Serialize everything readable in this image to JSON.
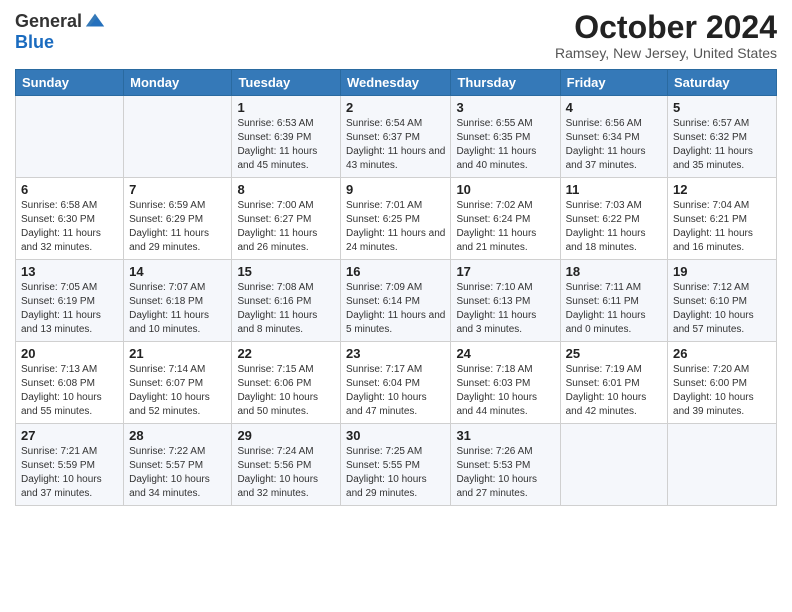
{
  "header": {
    "logo_general": "General",
    "logo_blue": "Blue",
    "title": "October 2024",
    "location": "Ramsey, New Jersey, United States"
  },
  "days_of_week": [
    "Sunday",
    "Monday",
    "Tuesday",
    "Wednesday",
    "Thursday",
    "Friday",
    "Saturday"
  ],
  "weeks": [
    [
      null,
      null,
      {
        "day": 1,
        "sunrise": "6:53 AM",
        "sunset": "6:39 PM",
        "daylight": "11 hours and 45 minutes."
      },
      {
        "day": 2,
        "sunrise": "6:54 AM",
        "sunset": "6:37 PM",
        "daylight": "11 hours and 43 minutes."
      },
      {
        "day": 3,
        "sunrise": "6:55 AM",
        "sunset": "6:35 PM",
        "daylight": "11 hours and 40 minutes."
      },
      {
        "day": 4,
        "sunrise": "6:56 AM",
        "sunset": "6:34 PM",
        "daylight": "11 hours and 37 minutes."
      },
      {
        "day": 5,
        "sunrise": "6:57 AM",
        "sunset": "6:32 PM",
        "daylight": "11 hours and 35 minutes."
      }
    ],
    [
      {
        "day": 6,
        "sunrise": "6:58 AM",
        "sunset": "6:30 PM",
        "daylight": "11 hours and 32 minutes."
      },
      {
        "day": 7,
        "sunrise": "6:59 AM",
        "sunset": "6:29 PM",
        "daylight": "11 hours and 29 minutes."
      },
      {
        "day": 8,
        "sunrise": "7:00 AM",
        "sunset": "6:27 PM",
        "daylight": "11 hours and 26 minutes."
      },
      {
        "day": 9,
        "sunrise": "7:01 AM",
        "sunset": "6:25 PM",
        "daylight": "11 hours and 24 minutes."
      },
      {
        "day": 10,
        "sunrise": "7:02 AM",
        "sunset": "6:24 PM",
        "daylight": "11 hours and 21 minutes."
      },
      {
        "day": 11,
        "sunrise": "7:03 AM",
        "sunset": "6:22 PM",
        "daylight": "11 hours and 18 minutes."
      },
      {
        "day": 12,
        "sunrise": "7:04 AM",
        "sunset": "6:21 PM",
        "daylight": "11 hours and 16 minutes."
      }
    ],
    [
      {
        "day": 13,
        "sunrise": "7:05 AM",
        "sunset": "6:19 PM",
        "daylight": "11 hours and 13 minutes."
      },
      {
        "day": 14,
        "sunrise": "7:07 AM",
        "sunset": "6:18 PM",
        "daylight": "11 hours and 10 minutes."
      },
      {
        "day": 15,
        "sunrise": "7:08 AM",
        "sunset": "6:16 PM",
        "daylight": "11 hours and 8 minutes."
      },
      {
        "day": 16,
        "sunrise": "7:09 AM",
        "sunset": "6:14 PM",
        "daylight": "11 hours and 5 minutes."
      },
      {
        "day": 17,
        "sunrise": "7:10 AM",
        "sunset": "6:13 PM",
        "daylight": "11 hours and 3 minutes."
      },
      {
        "day": 18,
        "sunrise": "7:11 AM",
        "sunset": "6:11 PM",
        "daylight": "11 hours and 0 minutes."
      },
      {
        "day": 19,
        "sunrise": "7:12 AM",
        "sunset": "6:10 PM",
        "daylight": "10 hours and 57 minutes."
      }
    ],
    [
      {
        "day": 20,
        "sunrise": "7:13 AM",
        "sunset": "6:08 PM",
        "daylight": "10 hours and 55 minutes."
      },
      {
        "day": 21,
        "sunrise": "7:14 AM",
        "sunset": "6:07 PM",
        "daylight": "10 hours and 52 minutes."
      },
      {
        "day": 22,
        "sunrise": "7:15 AM",
        "sunset": "6:06 PM",
        "daylight": "10 hours and 50 minutes."
      },
      {
        "day": 23,
        "sunrise": "7:17 AM",
        "sunset": "6:04 PM",
        "daylight": "10 hours and 47 minutes."
      },
      {
        "day": 24,
        "sunrise": "7:18 AM",
        "sunset": "6:03 PM",
        "daylight": "10 hours and 44 minutes."
      },
      {
        "day": 25,
        "sunrise": "7:19 AM",
        "sunset": "6:01 PM",
        "daylight": "10 hours and 42 minutes."
      },
      {
        "day": 26,
        "sunrise": "7:20 AM",
        "sunset": "6:00 PM",
        "daylight": "10 hours and 39 minutes."
      }
    ],
    [
      {
        "day": 27,
        "sunrise": "7:21 AM",
        "sunset": "5:59 PM",
        "daylight": "10 hours and 37 minutes."
      },
      {
        "day": 28,
        "sunrise": "7:22 AM",
        "sunset": "5:57 PM",
        "daylight": "10 hours and 34 minutes."
      },
      {
        "day": 29,
        "sunrise": "7:24 AM",
        "sunset": "5:56 PM",
        "daylight": "10 hours and 32 minutes."
      },
      {
        "day": 30,
        "sunrise": "7:25 AM",
        "sunset": "5:55 PM",
        "daylight": "10 hours and 29 minutes."
      },
      {
        "day": 31,
        "sunrise": "7:26 AM",
        "sunset": "5:53 PM",
        "daylight": "10 hours and 27 minutes."
      },
      null,
      null
    ]
  ]
}
